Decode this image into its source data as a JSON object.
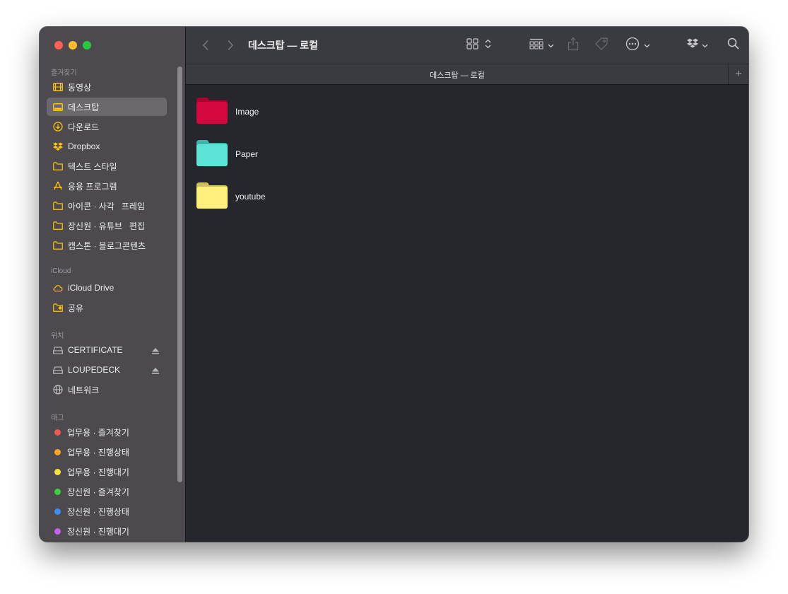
{
  "window": {
    "title": "데스크탑 — 로컬"
  },
  "tab": {
    "title": "데스크탑 — 로컬",
    "add_label": "+"
  },
  "sidebar": {
    "favorites_title": "즐겨찾기",
    "favorites": [
      {
        "label": "동영상",
        "icon": "film-icon"
      },
      {
        "label": "데스크탑",
        "icon": "desktop-icon",
        "selected": true
      },
      {
        "label": "다운로드",
        "icon": "download-icon"
      },
      {
        "label": "Dropbox",
        "icon": "dropbox-icon"
      },
      {
        "label": "텍스트 스타일",
        "icon": "folder-icon"
      },
      {
        "label": "응용 프로그램",
        "icon": "applications-icon"
      },
      {
        "label": "아이콘 · 사각   프레임",
        "icon": "folder-icon"
      },
      {
        "label": "장신원 · 유튜브   편집",
        "icon": "folder-icon"
      },
      {
        "label": "캡스톤 · 블로그콘텐츠",
        "icon": "folder-icon"
      }
    ],
    "icloud_title": "iCloud",
    "icloud": [
      {
        "label": "iCloud Drive",
        "icon": "cloud-icon"
      },
      {
        "label": "공유",
        "icon": "shared-folder-icon"
      }
    ],
    "locations_title": "위치",
    "locations": [
      {
        "label": "CERTIFICATE",
        "icon": "drive-icon",
        "eject": true
      },
      {
        "label": "LOUPEDECK",
        "icon": "drive-icon",
        "eject": true
      },
      {
        "label": "네트워크",
        "icon": "network-icon"
      }
    ],
    "tags_title": "태그",
    "tags": [
      {
        "label": "업무용 · 즐겨찾기",
        "color": "#ee5a52"
      },
      {
        "label": "업무용 · 진행상태",
        "color": "#f5a623"
      },
      {
        "label": "업무용 · 진행대기",
        "color": "#f7e13b"
      },
      {
        "label": "장신원 · 즐겨찾기",
        "color": "#3ad13f"
      },
      {
        "label": "장신원 · 진행상태",
        "color": "#3a8ef5"
      },
      {
        "label": "장신원 · 진행대기",
        "color": "#c661e8"
      }
    ]
  },
  "files": [
    {
      "name": "Image",
      "color": "#d4083f",
      "tab_color": "#a5062f"
    },
    {
      "name": "Paper",
      "color": "#5de3d6",
      "tab_color": "#3fb4aa"
    },
    {
      "name": "youtube",
      "color": "#fdf07a",
      "tab_color": "#cfc25a"
    }
  ],
  "colors": {
    "accent": "#fec309",
    "sidebar_bg": "#4c4a4f",
    "content_bg": "#25272d"
  }
}
